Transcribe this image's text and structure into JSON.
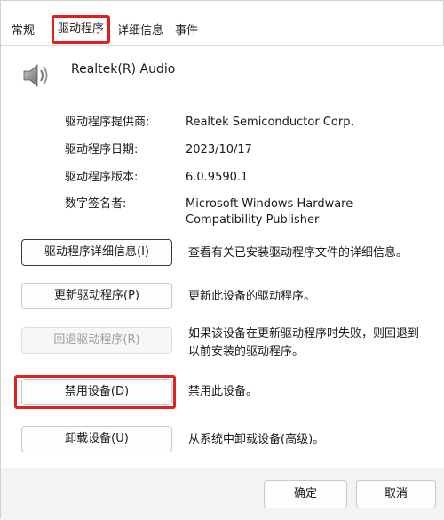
{
  "tabs": [
    {
      "label": "常规"
    },
    {
      "label": "驱动程序"
    },
    {
      "label": "详细信息"
    },
    {
      "label": "事件"
    }
  ],
  "device": {
    "name": "Realtek(R) Audio",
    "icon": "speaker-icon"
  },
  "properties": [
    {
      "label": "驱动程序提供商:",
      "value": "Realtek Semiconductor Corp."
    },
    {
      "label": "驱动程序日期:",
      "value": "2023/10/17"
    },
    {
      "label": "驱动程序版本:",
      "value": "6.0.9590.1"
    },
    {
      "label": "数字签名者:",
      "value": "Microsoft Windows Hardware Compatibility Publisher"
    }
  ],
  "actions": [
    {
      "label": "驱动程序详细信息(I)",
      "description": "查看有关已安装驱动程序文件的详细信息。"
    },
    {
      "label": "更新驱动程序(P)",
      "description": "更新此设备的驱动程序。"
    },
    {
      "label": "回退驱动程序(R)",
      "description": "如果该设备在更新驱动程序时失败，则回退到以前安装的驱动程序。"
    },
    {
      "label": "禁用设备(D)",
      "description": "禁用此设备。"
    },
    {
      "label": "卸载设备(U)",
      "description": "从系统中卸载设备(高级)。"
    }
  ],
  "footer": {
    "ok_label": "确定",
    "cancel_label": "取消"
  },
  "colors": {
    "highlight": "#e02020",
    "disabled_text": "#9c9c9c",
    "footer_bg": "#f3f3f3"
  }
}
